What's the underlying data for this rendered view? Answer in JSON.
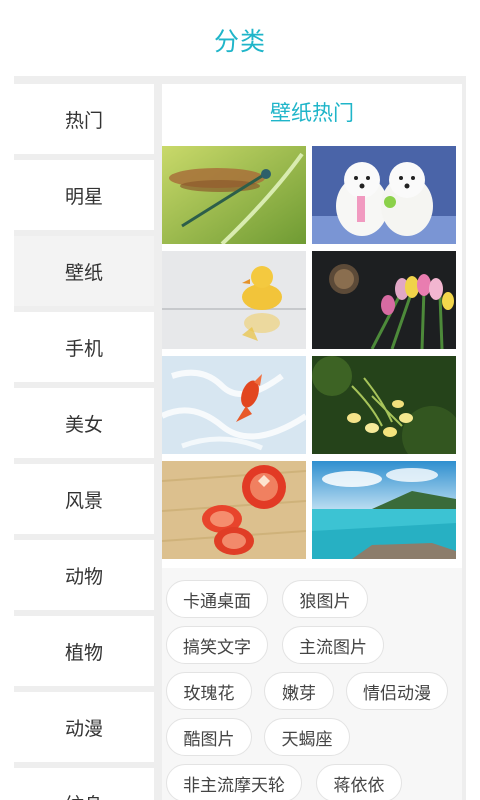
{
  "header": {
    "title": "分类"
  },
  "sidebar": {
    "items": [
      {
        "label": "热门"
      },
      {
        "label": "明星"
      },
      {
        "label": "壁纸"
      },
      {
        "label": "手机"
      },
      {
        "label": "美女"
      },
      {
        "label": "风景"
      },
      {
        "label": "动物"
      },
      {
        "label": "植物"
      },
      {
        "label": "动漫"
      },
      {
        "label": "纹身"
      }
    ],
    "active_index": 2
  },
  "main": {
    "section_title": "壁纸热门",
    "images": [
      {
        "subject": "dragonfly"
      },
      {
        "subject": "white puppies"
      },
      {
        "subject": "duckling"
      },
      {
        "subject": "tulips and coffee"
      },
      {
        "subject": "goldfish"
      },
      {
        "subject": "flowers"
      },
      {
        "subject": "tomatoes"
      },
      {
        "subject": "seaside"
      }
    ],
    "tags": [
      {
        "label": "卡通桌面"
      },
      {
        "label": "狼图片"
      },
      {
        "label": "搞笑文字"
      },
      {
        "label": "主流图片"
      },
      {
        "label": "玫瑰花"
      },
      {
        "label": "嫩芽"
      },
      {
        "label": "情侣动漫"
      },
      {
        "label": "酷图片"
      },
      {
        "label": "天蝎座"
      },
      {
        "label": "非主流摩天轮"
      },
      {
        "label": "蒋依依"
      }
    ]
  },
  "colors": {
    "accent": "#1fb5c9",
    "background": "#eeeeee"
  }
}
